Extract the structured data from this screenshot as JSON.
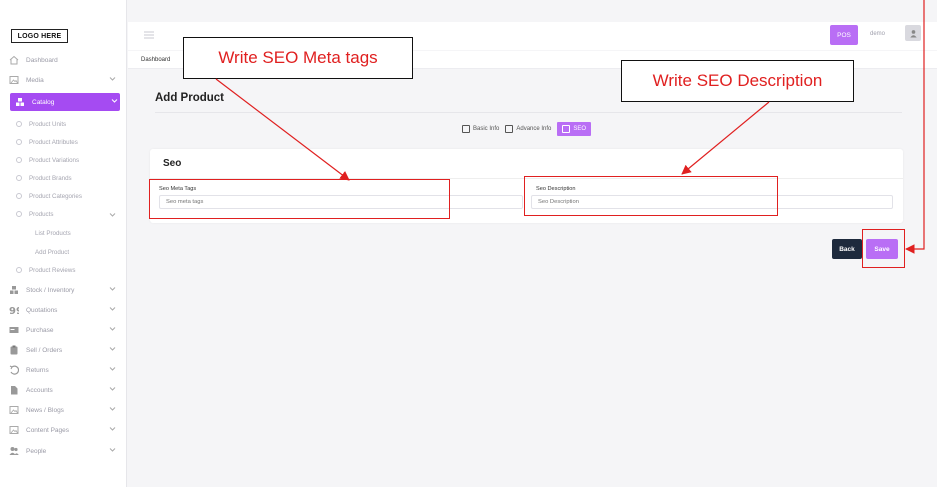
{
  "logo": {
    "text": "LOGO HERE"
  },
  "sidebar": {
    "items": [
      {
        "label": "Dashboard",
        "icon": "home-icon",
        "chevron": false
      },
      {
        "label": "Media",
        "icon": "image-icon",
        "chevron": true
      },
      {
        "label": "Catalog",
        "icon": "catalog-icon",
        "chevron": true,
        "active": true
      }
    ],
    "catalog_sub": [
      {
        "label": "Product Units"
      },
      {
        "label": "Product Attributes"
      },
      {
        "label": "Product Variations"
      },
      {
        "label": "Product Brands"
      },
      {
        "label": "Product Categories"
      },
      {
        "label": "Products"
      }
    ],
    "products_sub": [
      {
        "label": "List Products"
      },
      {
        "label": "Add Product"
      }
    ],
    "after_products": {
      "label": "Product Reviews"
    },
    "more_items": [
      {
        "label": "Stock / Inventory",
        "icon": "boxes-icon"
      },
      {
        "label": "Quotations",
        "icon": "quote-icon"
      },
      {
        "label": "Purchase",
        "icon": "card-icon"
      },
      {
        "label": "Sell / Orders",
        "icon": "clipboard-icon"
      },
      {
        "label": "Returns",
        "icon": "return-icon"
      },
      {
        "label": "Accounts",
        "icon": "file-icon"
      },
      {
        "label": "News / Blogs",
        "icon": "image-icon"
      },
      {
        "label": "Content Pages",
        "icon": "image-icon"
      },
      {
        "label": "People",
        "icon": "people-icon"
      }
    ]
  },
  "header": {
    "pos_label": "POS",
    "user_name": "demo",
    "breadcrumb": "Dashboard"
  },
  "page": {
    "title": "Add Product",
    "tabs": [
      {
        "label": "Basic Info"
      },
      {
        "label": "Advance Info"
      },
      {
        "label": "SEO",
        "active": true
      }
    ]
  },
  "seo": {
    "title": "Seo",
    "meta_label": "Seo Meta Tags",
    "meta_placeholder": "Seo meta tags",
    "desc_label": "Seo Description",
    "desc_placeholder": "Seo Description"
  },
  "actions": {
    "back": "Back",
    "save": "Save"
  },
  "annotations": {
    "meta_callout": "Write SEO Meta tags",
    "desc_callout": "Write SEO Description"
  },
  "colors": {
    "accent": "#b96ef5",
    "active_nav": "#a54bf2",
    "dark_button": "#1e2a3d",
    "annotation_red": "#e02020"
  }
}
